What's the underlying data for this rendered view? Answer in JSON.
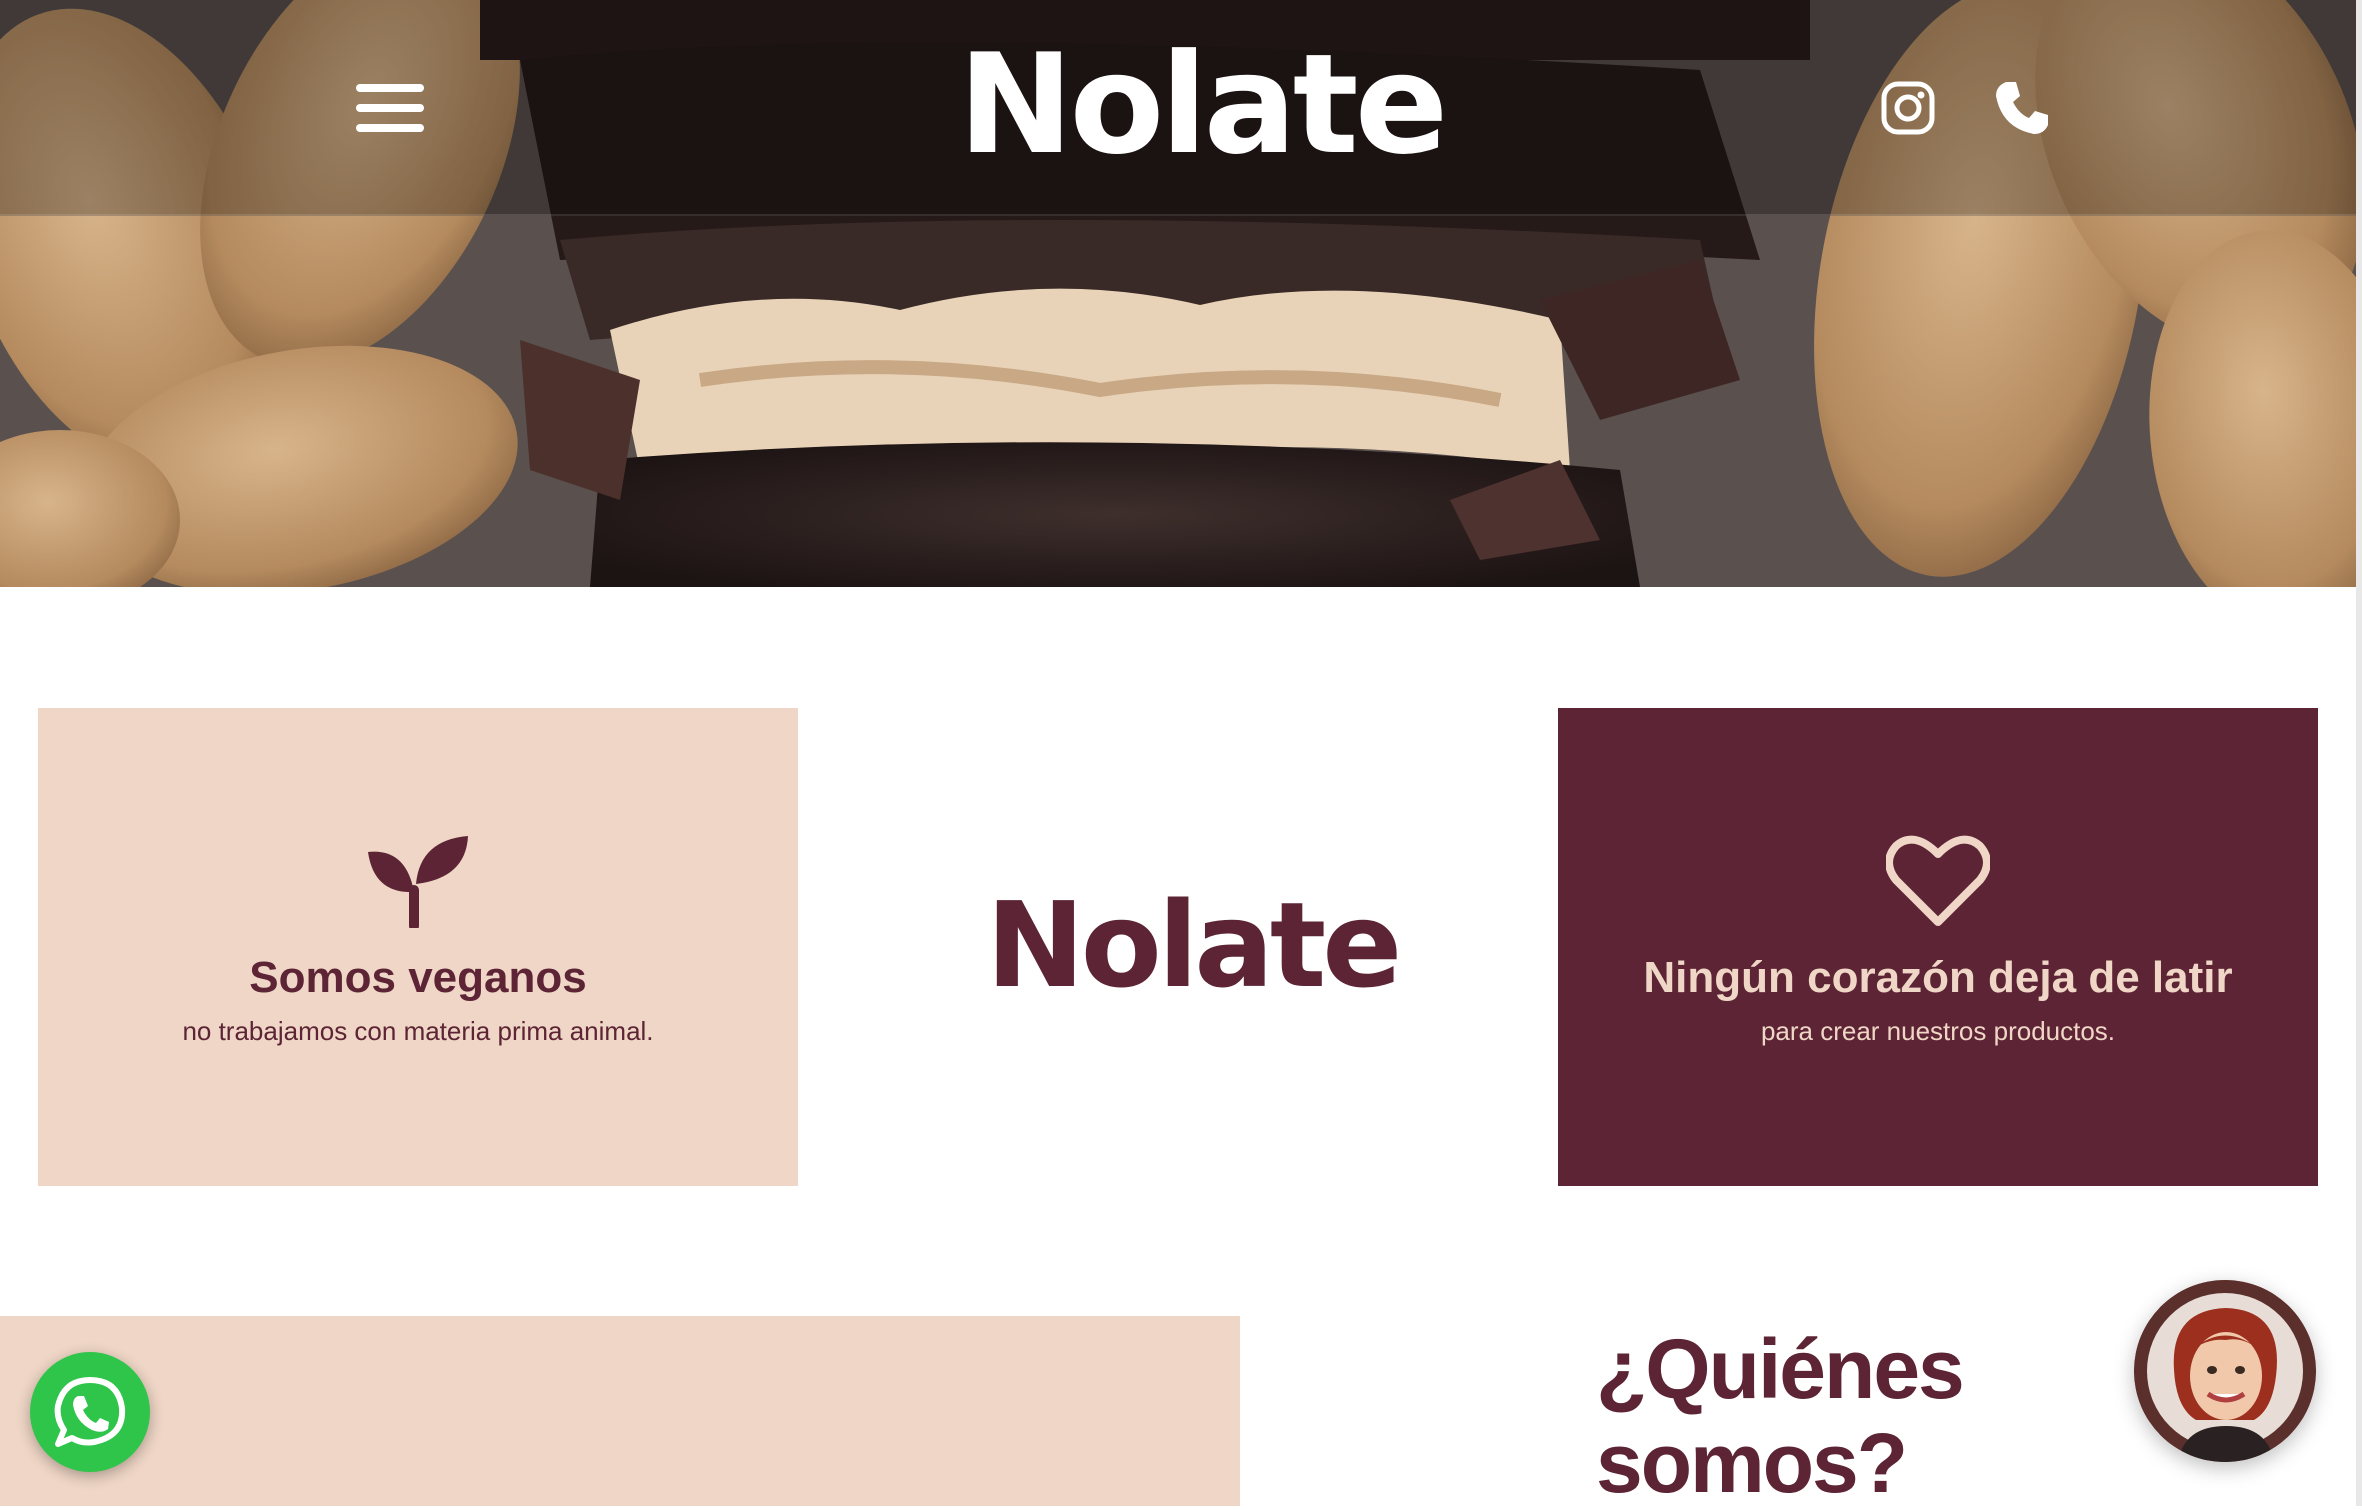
{
  "header": {
    "logo_text": "Nolate",
    "menu_icon": "hamburger-menu-icon",
    "social_icons": [
      "instagram-icon",
      "phone-icon"
    ]
  },
  "hero": {
    "image_description_icon": "chocolate-peanut-cookie-image"
  },
  "features": {
    "left": {
      "icon": "sprout-icon",
      "title": "Somos veganos",
      "subtitle": "no trabajamos con materia prima animal."
    },
    "center_logo_text": "Nolate",
    "right": {
      "icon": "heart-icon",
      "title": "Ningún corazón deja de latir",
      "subtitle": "para crear nuestros productos."
    }
  },
  "about": {
    "title": "¿Quiénes somos?"
  },
  "floating": {
    "whatsapp_icon": "whatsapp-icon",
    "chat_avatar": "support-avatar"
  },
  "colors": {
    "brand_maroon": "#5c2434",
    "brand_cream": "#efd6c6",
    "whatsapp_green": "#2fc44a",
    "white": "#ffffff"
  }
}
